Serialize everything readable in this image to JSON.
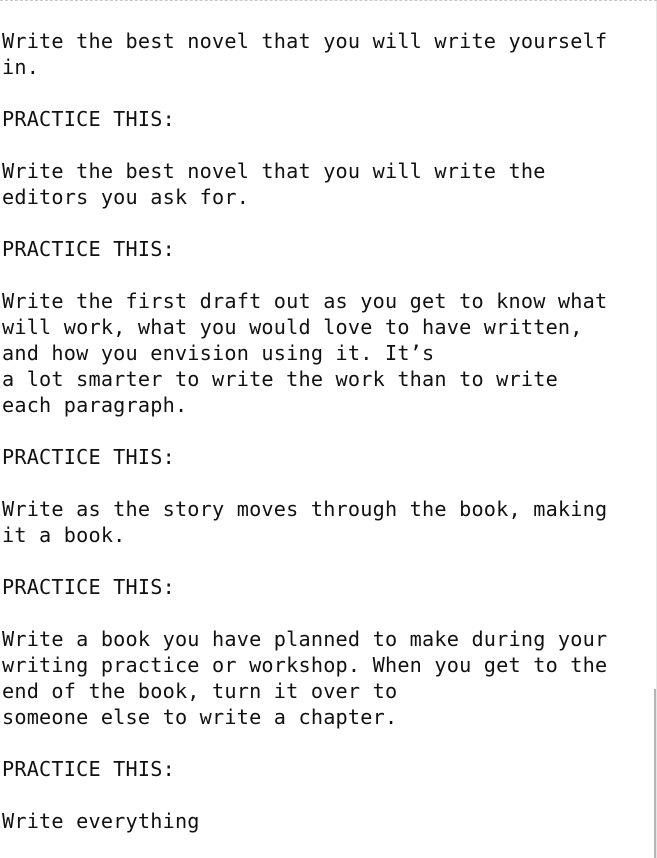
{
  "document": {
    "paragraphs": [
      {
        "lines": [
          "Write the best novel that you will write yourself",
          "in."
        ]
      },
      {
        "lines": [
          "PRACTICE THIS:"
        ]
      },
      {
        "lines": [
          "Write the best novel that you will write the",
          "editors you ask for."
        ]
      },
      {
        "lines": [
          "PRACTICE THIS:"
        ]
      },
      {
        "lines": [
          "Write the first draft out as you get to know what",
          "will work, what you would love to have written,",
          "and how you envision using it. It’s",
          "a lot smarter to write the work than to write",
          "each paragraph."
        ]
      },
      {
        "lines": [
          "PRACTICE THIS:"
        ]
      },
      {
        "lines": [
          "Write as the story moves through the book, making",
          "it a book."
        ]
      },
      {
        "lines": [
          "PRACTICE THIS:"
        ]
      },
      {
        "lines": [
          "Write a book you have planned to make during your",
          "writing practice or workshop. When you get to the",
          "end of the book, turn it over to",
          "someone else to write a chapter."
        ]
      },
      {
        "lines": [
          "PRACTICE THIS:"
        ]
      },
      {
        "lines": [
          "Write everything"
        ]
      }
    ]
  },
  "colors": {
    "text": "#111111",
    "background": "#ffffff",
    "scrollbar_thumb": "#b5b5b5"
  }
}
